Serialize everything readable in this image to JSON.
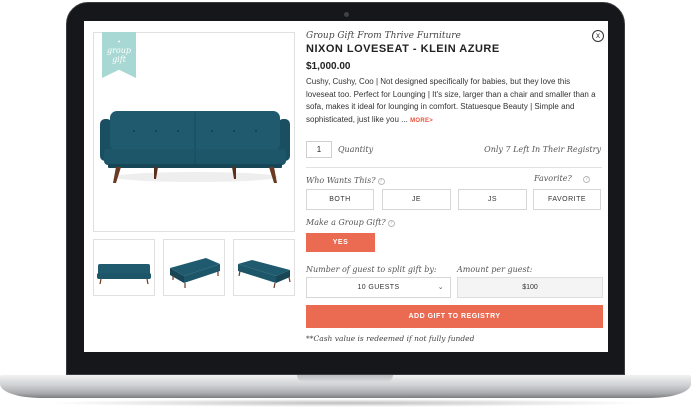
{
  "modal": {
    "ribbon_line1": "group",
    "ribbon_line2": "gift",
    "subtitle": "Group Gift From Thrive Furniture",
    "title": "NIXON LOVESEAT - KLEIN AZURE",
    "price": "$1,000.00",
    "description": "Cushy, Cushy, Coo | Not designed specifically for babies, but they love this loveseat too. Perfect for Lounging | It's size, larger than a chair and smaller than a sofa, makes it ideal for lounging in comfort. Statuesque Beauty | Simple and sophisticated, just like you ...",
    "more_label": "MORE>",
    "close_label": "x"
  },
  "quantity": {
    "value": "1",
    "label": "Quantity",
    "availability": "Only 7 Left In Their Registry"
  },
  "wants": {
    "label": "Who Wants This?",
    "options": [
      "BOTH",
      "JE",
      "JS"
    ],
    "favorite_label": "Favorite?",
    "favorite_button": "FAVORITE"
  },
  "group_gift": {
    "label": "Make a Group Gift?",
    "yes_button": "YES",
    "guests_label": "Number of guest to split gift by:",
    "guests_value": "10 GUESTS",
    "amount_label": "Amount per guest:",
    "amount_value": "$100"
  },
  "actions": {
    "add_button": "ADD GIFT TO REGISTRY",
    "footnote": "**Cash value is redeemed if not fully funded"
  },
  "icons": {
    "help": "help-circle-icon",
    "close": "close-icon",
    "chevron": "chevron-down-icon"
  },
  "colors": {
    "accent": "#ea6a52",
    "sofa": "#1f5a6e",
    "ribbon": "#a8d8d3",
    "laptop_bezel": "#16171a"
  }
}
